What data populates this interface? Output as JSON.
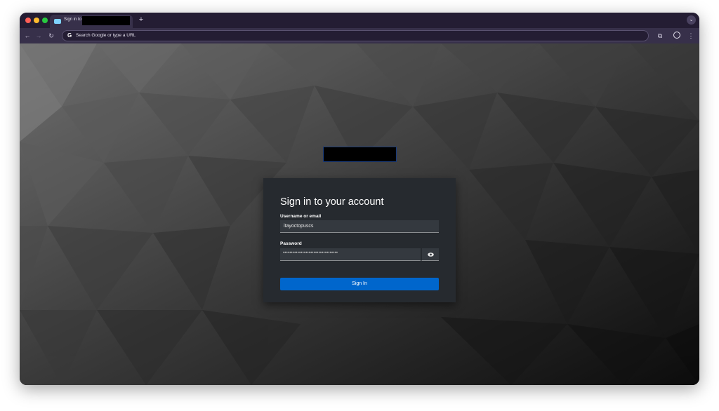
{
  "browser": {
    "tab": {
      "title": "Sign in to"
    },
    "new_tab_label": "+",
    "omnibox": {
      "placeholder": "Search Google or type a URL"
    }
  },
  "login": {
    "title": "Sign in to your account",
    "username": {
      "label": "Username or email",
      "value": "itayoctopuscs"
    },
    "password": {
      "label": "Password",
      "masked_value": "••••••••••••••••••••••••••••••••••"
    },
    "submit_label": "Sign In"
  },
  "colors": {
    "primary_button": "#0066cc",
    "card_bg": "#262a2f",
    "field_bg": "#34393f",
    "tab_bar": "#241d33"
  },
  "icons": [
    "back-arrow-icon",
    "forward-arrow-icon",
    "reload-icon",
    "google-icon",
    "extensions-icon",
    "profile-icon",
    "kebab-menu-icon",
    "show-password-eye-icon",
    "tab-dropdown-icon"
  ]
}
